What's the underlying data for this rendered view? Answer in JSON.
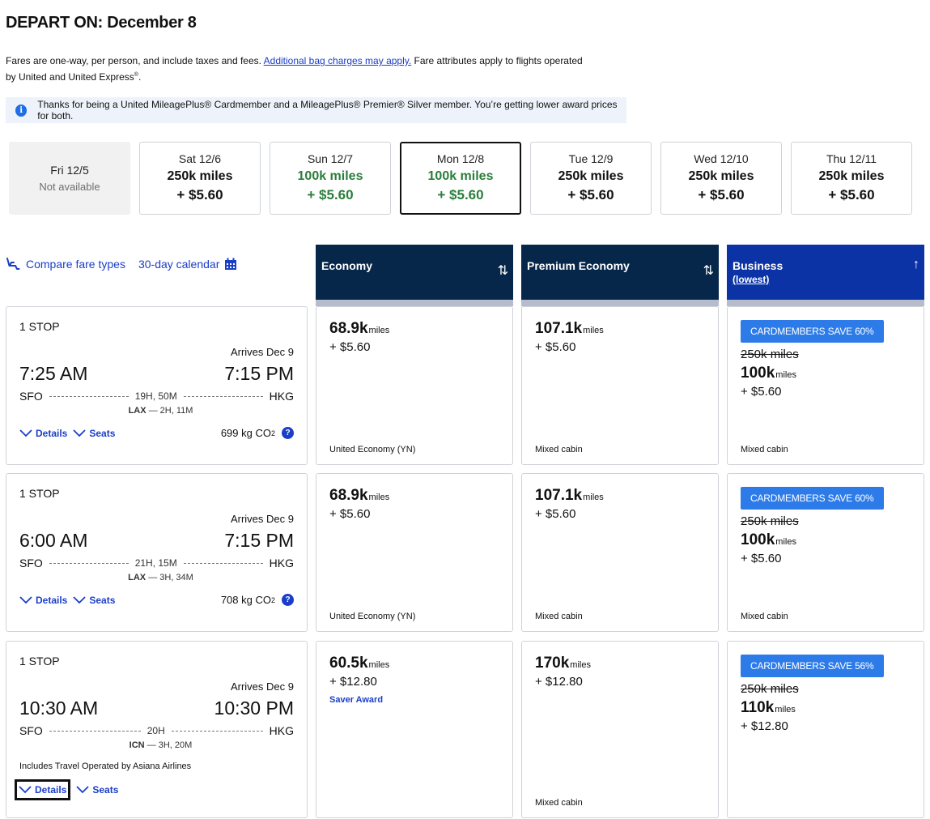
{
  "header": {
    "title": "DEPART ON: December 8"
  },
  "notice": {
    "text1": "Fares are one-way, per person, and include taxes and fees.",
    "link": "Additional bag charges may apply.",
    "text2": "Fare attributes apply to flights operated by United and United Express",
    "reg": "®",
    "end": "."
  },
  "banner": {
    "icon": "i",
    "text": "Thanks for being a United MileagePlus® Cardmember and a MileagePlus® Premier® Silver member. You’re getting lower award prices for both."
  },
  "dates": [
    {
      "day": "Fri 12/5",
      "status": "Not available"
    },
    {
      "day": "Sat 12/6",
      "miles": "250k miles",
      "price": "+ $5.60"
    },
    {
      "day": "Sun 12/7",
      "miles": "100k miles",
      "price": "+ $5.60"
    },
    {
      "day": "Mon 12/8",
      "miles": "100k miles",
      "price": "+ $5.60"
    },
    {
      "day": "Tue 12/9",
      "miles": "250k miles",
      "price": "+ $5.60"
    },
    {
      "day": "Wed 12/10",
      "miles": "250k miles",
      "price": "+ $5.60"
    },
    {
      "day": "Thu 12/11",
      "miles": "250k miles",
      "price": "+ $5.60"
    }
  ],
  "colors": {
    "navy": "#06264a",
    "business": "#0b33a6",
    "link": "#1a3ec8",
    "green": "#2a7d3b",
    "badge": "#2c7be8"
  },
  "tools": {
    "compare": "Compare fare types",
    "calendar": "30-day calendar"
  },
  "cabins": {
    "economy": {
      "label": "Economy",
      "sort": "⇅"
    },
    "premium": {
      "label": "Premium Economy",
      "sort": "⇅"
    },
    "business": {
      "label": "Business",
      "sub": "(lowest)",
      "sort": "↑"
    }
  },
  "common": {
    "unit": "miles",
    "details": "Details",
    "seats": "Seats"
  },
  "flights": [
    {
      "stops": "1 STOP",
      "arrives": "Arrives Dec 9",
      "depart": "7:25 AM",
      "arrive": "7:15 PM",
      "from": "SFO",
      "to": "HKG",
      "duration": "19H, 50M",
      "layover_code": "LAX",
      "layover_time": "— 2H, 11M",
      "co2": "699 kg CO",
      "co2_sub": "2",
      "economy": {
        "miles": "68.9k",
        "price": "+ $5.60",
        "class": "United Economy (YN)"
      },
      "premium": {
        "miles": "107.1k",
        "price": "+ $5.60",
        "class": "Mixed cabin"
      },
      "business": {
        "badge": "CARDMEMBERS SAVE 60%",
        "old": "250k miles",
        "miles": "100k",
        "price": "+ $5.60",
        "class": "Mixed cabin"
      }
    },
    {
      "stops": "1 STOP",
      "arrives": "Arrives Dec 9",
      "depart": "6:00 AM",
      "arrive": "7:15 PM",
      "from": "SFO",
      "to": "HKG",
      "duration": "21H, 15M",
      "layover_code": "LAX",
      "layover_time": "— 3H, 34M",
      "co2": "708 kg CO",
      "co2_sub": "2",
      "economy": {
        "miles": "68.9k",
        "price": "+ $5.60",
        "class": "United Economy (YN)"
      },
      "premium": {
        "miles": "107.1k",
        "price": "+ $5.60",
        "class": "Mixed cabin"
      },
      "business": {
        "badge": "CARDMEMBERS SAVE 60%",
        "old": "250k miles",
        "miles": "100k",
        "price": "+ $5.60",
        "class": "Mixed cabin"
      }
    },
    {
      "stops": "1 STOP",
      "arrives": "Arrives Dec 9",
      "depart": "10:30 AM",
      "arrive": "10:30 PM",
      "from": "SFO",
      "to": "HKG",
      "duration": "20H",
      "layover_code": "ICN",
      "layover_time": "— 3H, 20M",
      "operated": "Includes Travel Operated by Asiana Airlines",
      "economy": {
        "miles": "60.5k",
        "price": "+ $12.80",
        "saver": "Saver Award"
      },
      "premium": {
        "miles": "170k",
        "price": "+ $12.80",
        "class": "Mixed cabin"
      },
      "business": {
        "badge": "CARDMEMBERS SAVE 56%",
        "old": "250k miles",
        "miles": "110k",
        "price": "+ $12.80"
      }
    }
  ]
}
